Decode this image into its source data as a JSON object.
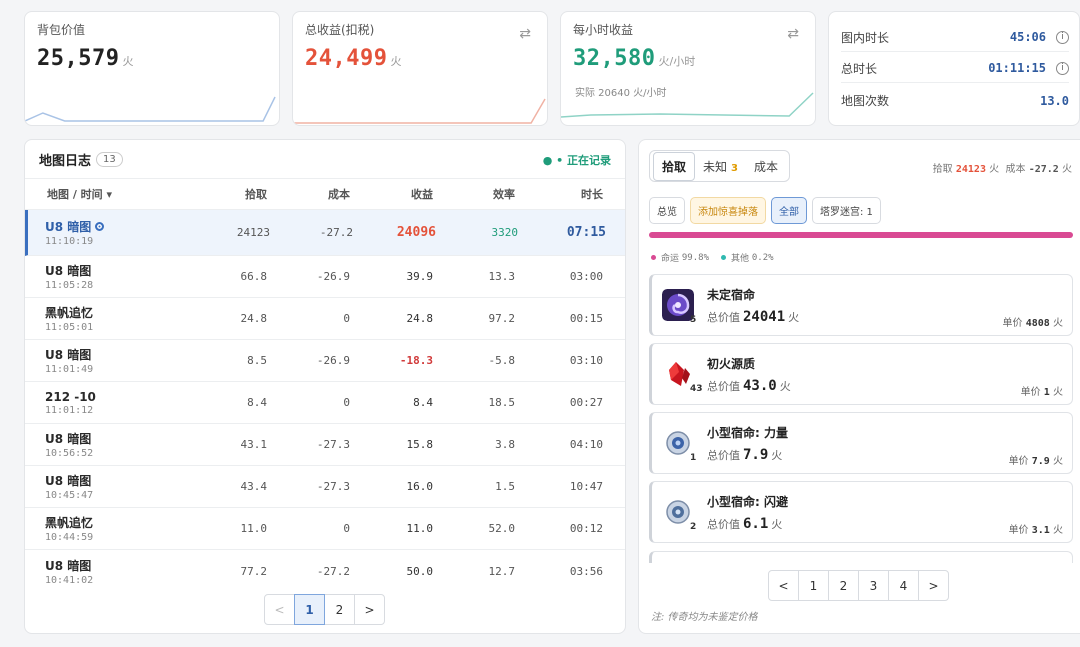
{
  "stats": {
    "bag": {
      "label": "背包价值",
      "value": "25,579",
      "unit": "火"
    },
    "profit": {
      "label": "总收益(扣税)",
      "value": "24,499",
      "unit": "火"
    },
    "hourly": {
      "label": "每小时收益",
      "value": "32,580",
      "unit": "火/小时",
      "sub": "实际 20640 火/小时"
    },
    "colors": {
      "profit": "#e4523a",
      "hourly": "#1f9c7a",
      "bag": "#222222"
    }
  },
  "times": [
    {
      "label": "图内时长",
      "value": "45:06",
      "info": "i"
    },
    {
      "label": "总时长",
      "value": "01:11:15",
      "info": "i"
    },
    {
      "label": "地图次数",
      "value": "13.0"
    }
  ],
  "log": {
    "title": "地图日志",
    "count": "13",
    "recording": "• 正在记录",
    "headers": [
      "地图 / 时间 ▾",
      "拾取",
      "成本",
      "收益",
      "效率",
      "时长"
    ],
    "rows": [
      {
        "name": "U8 暗图",
        "time": "11:10:19",
        "pick": "24123",
        "cost": "-27.2",
        "profit": "24096",
        "eff": "3320",
        "dur": "07:15"
      },
      {
        "name": "U8 暗图",
        "time": "11:05:28",
        "pick": "66.8",
        "cost": "-26.9",
        "profit": "39.9",
        "eff": "13.3",
        "dur": "03:00"
      },
      {
        "name": "黑帆追忆",
        "time": "11:05:01",
        "pick": "24.8",
        "cost": "0",
        "profit": "24.8",
        "eff": "97.2",
        "dur": "00:15"
      },
      {
        "name": "U8 暗图",
        "time": "11:01:49",
        "pick": "8.5",
        "cost": "-26.9",
        "profit": "-18.3",
        "eff": "-5.8",
        "dur": "03:10"
      },
      {
        "name": "212 -10",
        "time": "11:01:12",
        "pick": "8.4",
        "cost": "0",
        "profit": "8.4",
        "eff": "18.5",
        "dur": "00:27"
      },
      {
        "name": "U8 暗图",
        "time": "10:56:52",
        "pick": "43.1",
        "cost": "-27.3",
        "profit": "15.8",
        "eff": "3.8",
        "dur": "04:10"
      },
      {
        "name": "U8 暗图",
        "time": "10:45:47",
        "pick": "43.4",
        "cost": "-27.3",
        "profit": "16.0",
        "eff": "1.5",
        "dur": "10:47"
      },
      {
        "name": "黑帆追忆",
        "time": "10:44:59",
        "pick": "11.0",
        "cost": "0",
        "profit": "11.0",
        "eff": "52.0",
        "dur": "00:12"
      },
      {
        "name": "U8 暗图",
        "time": "10:41:02",
        "pick": "77.2",
        "cost": "-27.2",
        "profit": "50.0",
        "eff": "12.7",
        "dur": "03:56"
      }
    ],
    "pager": [
      "<",
      "1",
      "2",
      ">"
    ]
  },
  "right": {
    "tabs": {
      "pick": "拾取",
      "unknown": "未知",
      "unknown_badge": "3",
      "cost": "成本"
    },
    "summary": {
      "pick_label": "拾取",
      "pick_value": "24123",
      "pick_unit": "火",
      "cost_label": "成本",
      "cost_value": "-27.2",
      "cost_unit": "火"
    },
    "filters": [
      "总览",
      "添加惊喜掉落",
      "全部",
      "塔罗迷宫: 1"
    ],
    "legend": [
      {
        "label": "命运",
        "value": "99.8%",
        "color": "#d94a93"
      },
      {
        "label": "其他",
        "value": "0.2%",
        "color": "#2fb9b0"
      }
    ],
    "items": [
      {
        "name": "未定宿命",
        "qty": "5",
        "total_label": "总价值",
        "total": "24041",
        "unit": "火",
        "price_label": "单价",
        "price": "4808",
        "price_unit": "火"
      },
      {
        "name": "初火源质",
        "qty": "43",
        "total_label": "总价值",
        "total": "43.0",
        "unit": "火",
        "price_label": "单价",
        "price": "1",
        "price_unit": "火"
      },
      {
        "name": "小型宿命: 力量",
        "qty": "1",
        "total_label": "总价值",
        "total": "7.9",
        "unit": "火",
        "price_label": "单价",
        "price": "7.9",
        "price_unit": "火"
      },
      {
        "name": "小型宿命: 闪避",
        "qty": "2",
        "total_label": "总价值",
        "total": "6.1",
        "unit": "火",
        "price_label": "单价",
        "price": "3.1",
        "price_unit": "火"
      }
    ],
    "pager": [
      "<",
      "1",
      "2",
      "3",
      "4",
      ">"
    ],
    "note": "注: 传奇均为未鉴定价格"
  }
}
